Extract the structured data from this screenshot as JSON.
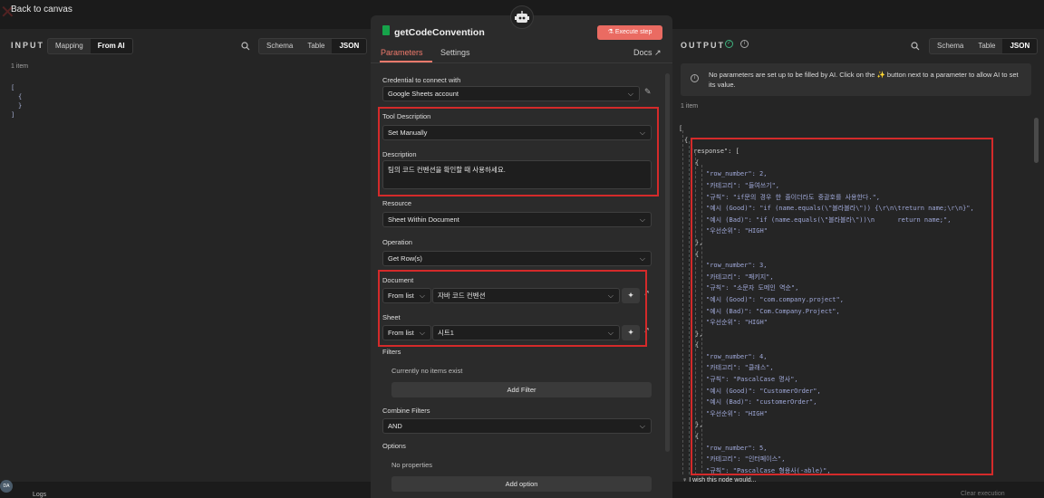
{
  "topbar": {
    "back_label": "Back to canvas"
  },
  "input": {
    "title": "INPUT",
    "modes": [
      "Mapping",
      "From AI"
    ],
    "views": [
      "Schema",
      "Table",
      "JSON"
    ],
    "count": "1 item",
    "json_lines": [
      "[",
      "{",
      "}",
      "]"
    ]
  },
  "node": {
    "title": "getCodeConvention",
    "execute_label": "Execute step",
    "tabs": [
      "Parameters",
      "Settings"
    ],
    "docs_label": "Docs",
    "credential_label": "Credential to connect with",
    "credential_value": "Google Sheets account",
    "tool_desc_label": "Tool Description",
    "tool_desc_value": "Set Manually",
    "description_label": "Description",
    "description_value": "팀의 코드 컨벤션을 확인할 때 사용하세요.",
    "resource_label": "Resource",
    "resource_value": "Sheet Within Document",
    "operation_label": "Operation",
    "operation_value": "Get Row(s)",
    "document_label": "Document",
    "document_mode": "From list",
    "document_value": "자바 코드 컨벤션",
    "sheet_label": "Sheet",
    "sheet_mode": "From list",
    "sheet_value": "시트1",
    "filters_label": "Filters",
    "filters_empty": "Currently no items exist",
    "add_filter_label": "Add Filter",
    "combine_label": "Combine Filters",
    "combine_value": "AND",
    "options_label": "Options",
    "options_empty": "No properties",
    "add_option_label": "Add option"
  },
  "output": {
    "title": "OUTPUT",
    "views": [
      "Schema",
      "Table",
      "JSON"
    ],
    "notice": "No parameters are set up to be filled by AI. Click on the ✨ button next to a parameter to allow AI to set its value.",
    "count": "1 item",
    "json_lines": [
      "[",
      "{",
      "\"response\": [",
      "{",
      "\"row_number\": 2,",
      "\"카테고리\": \"들여쓰기\",",
      "\"규칙\": \"if문의 경우 한 줄이더라도 중괄호를 사용한다.\",",
      "\"예시 (Good)\": \"if (name.equals(\\\"블라블라\\\")) {\\r\\n\\treturn name;\\r\\n}\",",
      "\"예시 (Bad)\": \"if (name.equals(\\\"블라블라\\\"))\\n      return name;\",",
      "\"우선순위\": \"HIGH\"",
      "},",
      "{",
      "\"row_number\": 3,",
      "\"카테고리\": \"패키지\",",
      "\"규칙\": \"소문자 도메인 역순\",",
      "\"예시 (Good)\": \"com.company.project\",",
      "\"예시 (Bad)\": \"Com.Company.Project\",",
      "\"우선순위\": \"HIGH\"",
      "},",
      "{",
      "\"row_number\": 4,",
      "\"카테고리\": \"클래스\",",
      "\"규칙\": \"PascalCase 명사\",",
      "\"예시 (Good)\": \"CustomerOrder\",",
      "\"예시 (Bad)\": \"customerOrder\",",
      "\"우선순위\": \"HIGH\"",
      "},",
      "{",
      "\"row_number\": 5,",
      "\"카테고리\": \"인터페이스\",",
      "\"규칙\": \"PascalCase 형용사(-able)\","
    ],
    "wish_label": "I wish this node would..."
  },
  "bottom": {
    "logs_label": "Logs",
    "clear_label": "Clear execution",
    "avatar_initials": "DA"
  },
  "colors": {
    "accent": "#ea6b62",
    "highlight": "#d42a2a"
  }
}
